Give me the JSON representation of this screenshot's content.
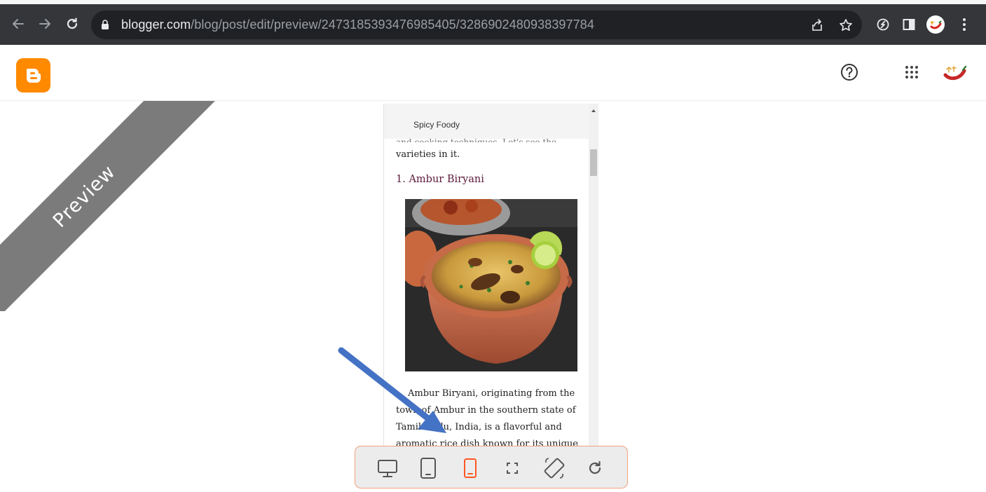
{
  "browser": {
    "url_host": "blogger.com",
    "url_path": "/blog/post/edit/preview/2473185393476985405/3286902480938397784"
  },
  "ribbon": {
    "label": "Preview"
  },
  "preview": {
    "blog_title": "Spicy Foody",
    "top_line_fragment": "and cooking techniques. Let's see the",
    "intro_end": "varieties in it.",
    "section_heading": "1. Ambur Biryani",
    "body_lines": [
      "Ambur Biryani, originating from the",
      "town of Ambur in the southern state of",
      "Tamil Nadu, India, is a flavorful and",
      "aromatic rice dish known for its unique"
    ]
  },
  "toolbar": {
    "items": [
      "desktop-view",
      "tablet-view",
      "mobile-view",
      "fullscreen",
      "rotate",
      "refresh"
    ],
    "active": "mobile-view"
  },
  "colors": {
    "accent": "#ff5722",
    "blogger_orange": "#ff8a00",
    "arrow": "#4472c4"
  }
}
